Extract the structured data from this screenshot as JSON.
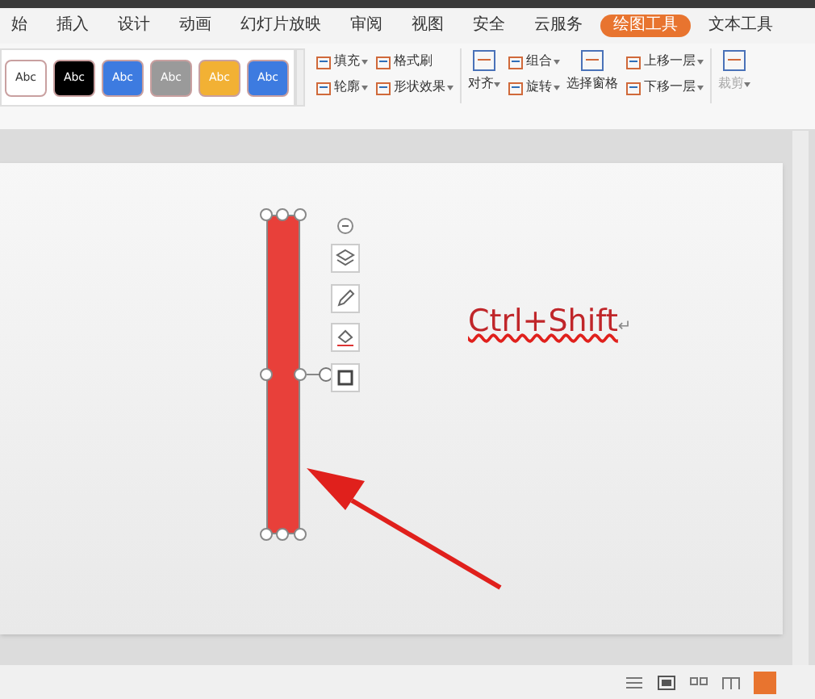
{
  "tabs": [
    {
      "label": "始",
      "selected": false
    },
    {
      "label": "插入",
      "selected": false
    },
    {
      "label": "设计",
      "selected": false
    },
    {
      "label": "动画",
      "selected": false
    },
    {
      "label": "幻灯片放映",
      "selected": false
    },
    {
      "label": "审阅",
      "selected": false
    },
    {
      "label": "视图",
      "selected": false
    },
    {
      "label": "安全",
      "selected": false
    },
    {
      "label": "云服务",
      "selected": false
    },
    {
      "label": "绘图工具",
      "selected": true
    },
    {
      "label": "文本工具",
      "selected": false
    }
  ],
  "styles": [
    {
      "label": "Abc",
      "color": "#ffffff"
    },
    {
      "label": "Abc",
      "color": "#000000"
    },
    {
      "label": "Abc",
      "color": "#3d7be0"
    },
    {
      "label": "Abc",
      "color": "#9a9a9a"
    },
    {
      "label": "Abc",
      "color": "#f2b134"
    },
    {
      "label": "Abc",
      "color": "#3d7be0"
    }
  ],
  "ribbon": [
    {
      "kind": "stack",
      "items": [
        {
          "label": "填充",
          "dropdown": true
        },
        {
          "label": "轮廓",
          "dropdown": true
        }
      ]
    },
    {
      "kind": "stack",
      "items": [
        {
          "label": "格式刷",
          "dropdown": false
        },
        {
          "label": "形状效果",
          "dropdown": true
        }
      ]
    },
    {
      "kind": "large",
      "label": "对齐",
      "dropdown": true,
      "disabled": false
    },
    {
      "kind": "stack",
      "items": [
        {
          "label": "组合",
          "dropdown": true
        },
        {
          "label": "旋转",
          "dropdown": true
        }
      ]
    },
    {
      "kind": "large",
      "label": "选择窗格",
      "dropdown": false,
      "disabled": false
    },
    {
      "kind": "stack",
      "items": [
        {
          "label": "上移一层",
          "dropdown": true
        },
        {
          "label": "下移一层",
          "dropdown": true
        }
      ]
    },
    {
      "kind": "large",
      "label": "裁剪",
      "dropdown": true,
      "disabled": true
    }
  ],
  "slide": {
    "text": "Ctrl+Shift",
    "paragraph_mark": "↵",
    "spelling_flag": true
  }
}
